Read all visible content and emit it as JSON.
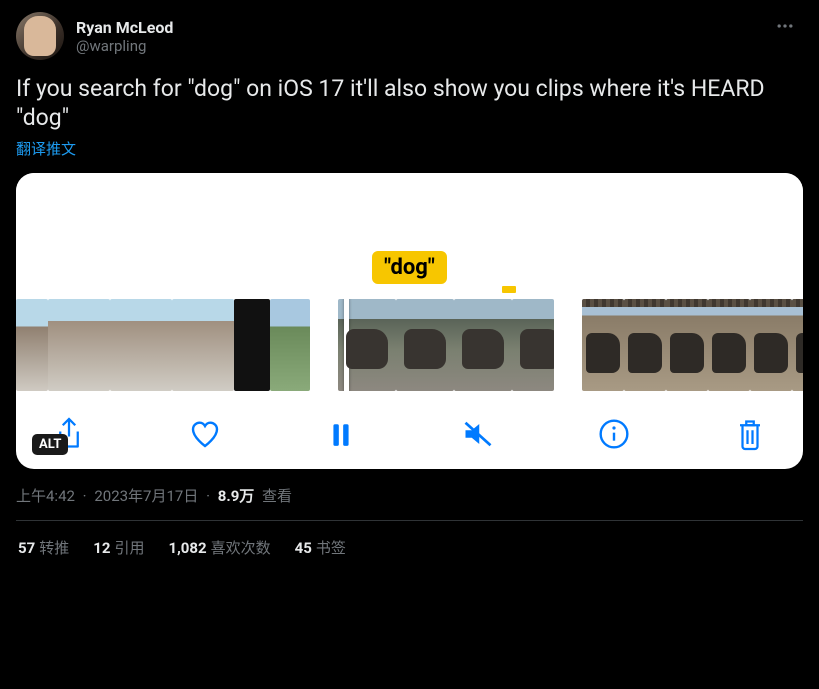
{
  "author": {
    "display_name": "Ryan McLeod",
    "handle": "@warpling"
  },
  "tweet_text": "If you search for \"dog\" on iOS 17 it'll also show you clips where it's HEARD \"dog\"",
  "translate_label": "翻译推文",
  "media": {
    "tag_text": "\"dog\"",
    "alt_badge": "ALT"
  },
  "meta": {
    "time": "上午4:42",
    "date": "2023年7月17日",
    "views_num": "8.9万",
    "views_label": "查看"
  },
  "stats": {
    "retweets_num": "57",
    "retweets_label": "转推",
    "quotes_num": "12",
    "quotes_label": "引用",
    "likes_num": "1,082",
    "likes_label": "喜欢次数",
    "bookmarks_num": "45",
    "bookmarks_label": "书签"
  }
}
